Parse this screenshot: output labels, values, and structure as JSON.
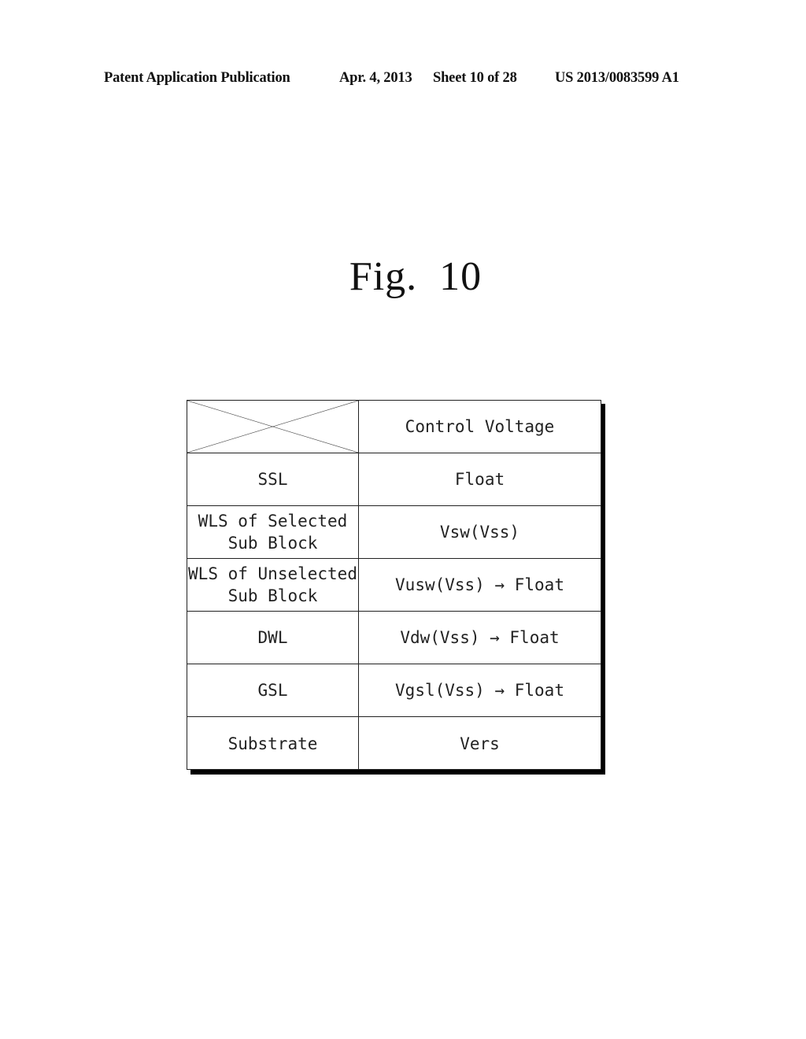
{
  "header": {
    "publication": "Patent Application Publication",
    "date": "Apr. 4, 2013",
    "sheet": "Sheet 10 of 28",
    "number": "US 2013/0083599 A1"
  },
  "figure": {
    "title": "Fig. 10"
  },
  "table": {
    "header_right": "Control Voltage",
    "rows": [
      {
        "line": "SSL",
        "voltage": "Float"
      },
      {
        "line": "WLS of Selected\nSub Block",
        "voltage": "Vsw(Vss)"
      },
      {
        "line": "WLS of Unselected\nSub Block",
        "voltage": "Vusw(Vss) → Float"
      },
      {
        "line": "DWL",
        "voltage": "Vdw(Vss) → Float"
      },
      {
        "line": "GSL",
        "voltage": "Vgsl(Vss) → Float"
      },
      {
        "line": "Substrate",
        "voltage": "Vers"
      }
    ]
  }
}
